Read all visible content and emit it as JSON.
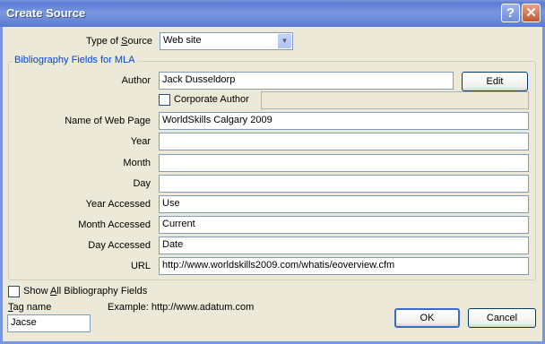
{
  "window": {
    "title": "Create Source",
    "help_icon": "?",
    "close_icon": "✕"
  },
  "type_of_source": {
    "label_pre": "Type of ",
    "label_accel": "S",
    "label_post": "ource",
    "value": "Web site",
    "arrow": "▼"
  },
  "group_title": "Bibliography Fields for MLA",
  "author": {
    "label": "Author",
    "value": "Jack Dusseldorp",
    "edit_label": "Edit"
  },
  "corporate_author": {
    "label": "Corporate Author",
    "value": ""
  },
  "fields": [
    {
      "label": "Name of Web Page",
      "value": "WorldSkills Calgary 2009"
    },
    {
      "label": "Year",
      "value": ""
    },
    {
      "label": "Month",
      "value": ""
    },
    {
      "label": "Day",
      "value": ""
    },
    {
      "label": "Year Accessed",
      "value": "Use"
    },
    {
      "label": "Month Accessed",
      "value": "Current"
    },
    {
      "label": "Day Accessed",
      "value": "Date"
    },
    {
      "label": "URL",
      "value": "http://www.worldskills2009.com/whatis/eoverview.cfm"
    }
  ],
  "show_all": {
    "label_pre": "Show ",
    "label_accel": "A",
    "label_post": "ll Bibliography Fields"
  },
  "tag": {
    "label_accel": "T",
    "label_post": "ag name",
    "value": "Jacse"
  },
  "example": "Example: http://www.adatum.com",
  "buttons": {
    "ok": "OK",
    "cancel": "Cancel"
  }
}
